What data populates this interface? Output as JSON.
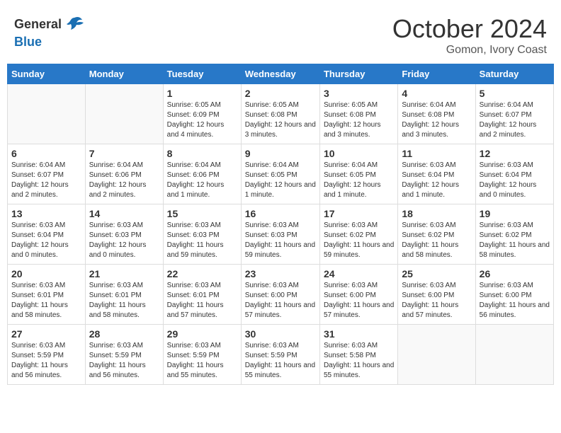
{
  "header": {
    "logo": {
      "general": "General",
      "blue": "Blue"
    },
    "title": "October 2024",
    "location": "Gomon, Ivory Coast"
  },
  "calendar": {
    "weekdays": [
      "Sunday",
      "Monday",
      "Tuesday",
      "Wednesday",
      "Thursday",
      "Friday",
      "Saturday"
    ],
    "weeks": [
      [
        {
          "day": "",
          "info": ""
        },
        {
          "day": "",
          "info": ""
        },
        {
          "day": "1",
          "info": "Sunrise: 6:05 AM\nSunset: 6:09 PM\nDaylight: 12 hours and 4 minutes."
        },
        {
          "day": "2",
          "info": "Sunrise: 6:05 AM\nSunset: 6:08 PM\nDaylight: 12 hours and 3 minutes."
        },
        {
          "day": "3",
          "info": "Sunrise: 6:05 AM\nSunset: 6:08 PM\nDaylight: 12 hours and 3 minutes."
        },
        {
          "day": "4",
          "info": "Sunrise: 6:04 AM\nSunset: 6:08 PM\nDaylight: 12 hours and 3 minutes."
        },
        {
          "day": "5",
          "info": "Sunrise: 6:04 AM\nSunset: 6:07 PM\nDaylight: 12 hours and 2 minutes."
        }
      ],
      [
        {
          "day": "6",
          "info": "Sunrise: 6:04 AM\nSunset: 6:07 PM\nDaylight: 12 hours and 2 minutes."
        },
        {
          "day": "7",
          "info": "Sunrise: 6:04 AM\nSunset: 6:06 PM\nDaylight: 12 hours and 2 minutes."
        },
        {
          "day": "8",
          "info": "Sunrise: 6:04 AM\nSunset: 6:06 PM\nDaylight: 12 hours and 1 minute."
        },
        {
          "day": "9",
          "info": "Sunrise: 6:04 AM\nSunset: 6:05 PM\nDaylight: 12 hours and 1 minute."
        },
        {
          "day": "10",
          "info": "Sunrise: 6:04 AM\nSunset: 6:05 PM\nDaylight: 12 hours and 1 minute."
        },
        {
          "day": "11",
          "info": "Sunrise: 6:03 AM\nSunset: 6:04 PM\nDaylight: 12 hours and 1 minute."
        },
        {
          "day": "12",
          "info": "Sunrise: 6:03 AM\nSunset: 6:04 PM\nDaylight: 12 hours and 0 minutes."
        }
      ],
      [
        {
          "day": "13",
          "info": "Sunrise: 6:03 AM\nSunset: 6:04 PM\nDaylight: 12 hours and 0 minutes."
        },
        {
          "day": "14",
          "info": "Sunrise: 6:03 AM\nSunset: 6:03 PM\nDaylight: 12 hours and 0 minutes."
        },
        {
          "day": "15",
          "info": "Sunrise: 6:03 AM\nSunset: 6:03 PM\nDaylight: 11 hours and 59 minutes."
        },
        {
          "day": "16",
          "info": "Sunrise: 6:03 AM\nSunset: 6:03 PM\nDaylight: 11 hours and 59 minutes."
        },
        {
          "day": "17",
          "info": "Sunrise: 6:03 AM\nSunset: 6:02 PM\nDaylight: 11 hours and 59 minutes."
        },
        {
          "day": "18",
          "info": "Sunrise: 6:03 AM\nSunset: 6:02 PM\nDaylight: 11 hours and 58 minutes."
        },
        {
          "day": "19",
          "info": "Sunrise: 6:03 AM\nSunset: 6:02 PM\nDaylight: 11 hours and 58 minutes."
        }
      ],
      [
        {
          "day": "20",
          "info": "Sunrise: 6:03 AM\nSunset: 6:01 PM\nDaylight: 11 hours and 58 minutes."
        },
        {
          "day": "21",
          "info": "Sunrise: 6:03 AM\nSunset: 6:01 PM\nDaylight: 11 hours and 58 minutes."
        },
        {
          "day": "22",
          "info": "Sunrise: 6:03 AM\nSunset: 6:01 PM\nDaylight: 11 hours and 57 minutes."
        },
        {
          "day": "23",
          "info": "Sunrise: 6:03 AM\nSunset: 6:00 PM\nDaylight: 11 hours and 57 minutes."
        },
        {
          "day": "24",
          "info": "Sunrise: 6:03 AM\nSunset: 6:00 PM\nDaylight: 11 hours and 57 minutes."
        },
        {
          "day": "25",
          "info": "Sunrise: 6:03 AM\nSunset: 6:00 PM\nDaylight: 11 hours and 57 minutes."
        },
        {
          "day": "26",
          "info": "Sunrise: 6:03 AM\nSunset: 6:00 PM\nDaylight: 11 hours and 56 minutes."
        }
      ],
      [
        {
          "day": "27",
          "info": "Sunrise: 6:03 AM\nSunset: 5:59 PM\nDaylight: 11 hours and 56 minutes."
        },
        {
          "day": "28",
          "info": "Sunrise: 6:03 AM\nSunset: 5:59 PM\nDaylight: 11 hours and 56 minutes."
        },
        {
          "day": "29",
          "info": "Sunrise: 6:03 AM\nSunset: 5:59 PM\nDaylight: 11 hours and 55 minutes."
        },
        {
          "day": "30",
          "info": "Sunrise: 6:03 AM\nSunset: 5:59 PM\nDaylight: 11 hours and 55 minutes."
        },
        {
          "day": "31",
          "info": "Sunrise: 6:03 AM\nSunset: 5:58 PM\nDaylight: 11 hours and 55 minutes."
        },
        {
          "day": "",
          "info": ""
        },
        {
          "day": "",
          "info": ""
        }
      ]
    ]
  }
}
